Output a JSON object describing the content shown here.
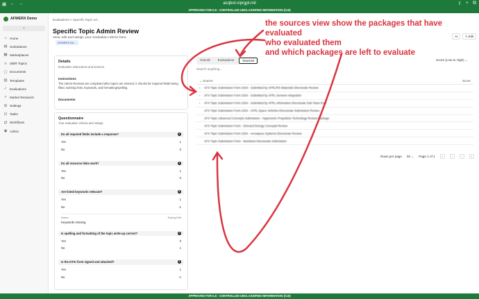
{
  "browser": {
    "url": "acqbot.niprgpt.mil"
  },
  "banner": {
    "text": "APPROVED FOR IL5 - CONTROLLED UNCLASSIFIED INFORMATION (CUI)"
  },
  "sidebar": {
    "org": "AFWERX Demo",
    "collapse_icon": "‹",
    "items": [
      {
        "label": "Home",
        "icon": "home-icon"
      },
      {
        "label": "Solicitations",
        "icon": "doc-icon"
      },
      {
        "label": "Marketplaces",
        "icon": "store-icon"
      },
      {
        "label": "SBIR Topics",
        "icon": "list-icon"
      },
      {
        "label": "Documents",
        "icon": "file-icon"
      },
      {
        "label": "Templates",
        "icon": "template-icon"
      },
      {
        "label": "Evaluations",
        "icon": "check-icon"
      },
      {
        "label": "Market Research",
        "icon": "search-icon"
      },
      {
        "label": "Settings",
        "icon": "gear-icon"
      },
      {
        "label": "Tasks",
        "icon": "task-icon"
      },
      {
        "label": "Workflows",
        "icon": "flow-icon"
      },
      {
        "label": "Admin",
        "icon": "admin-icon"
      }
    ]
  },
  "header": {
    "breadcrumb": "Evaluations >   Specific Topic Ad...",
    "title": "Specific Topic Admin Review",
    "subtitle": "View, edit and assign your evaluation rubrics here.",
    "tag": "AFWERX De...",
    "ai_label": "AI",
    "edit_label": "Edit"
  },
  "details": {
    "title": "Details",
    "subtitle": "Evaluation instructions and sources.",
    "instructions_label": "Instructions",
    "instructions_text": "The Admin Reviews are completed after topics are entered. It checks for required fields being filled, working links, keywords, and formatting/spelling.",
    "documents_label": "Documents"
  },
  "questionnaire": {
    "title": "Questionnaire",
    "subtitle": "Your evaluation criteria and ratings.",
    "questions": [
      {
        "q": "Do all required fields include a response?",
        "num": "1",
        "opts": [
          {
            "l": "Yes",
            "v": "1"
          },
          {
            "l": "No",
            "v": "0"
          }
        ]
      },
      {
        "q": "Do all resource links work?",
        "num": "1",
        "opts": [
          {
            "l": "Yes",
            "v": "1"
          },
          {
            "l": "No",
            "v": "0"
          }
        ]
      },
      {
        "q": "Are listed keywords relevant?",
        "num": "1",
        "opts": [
          {
            "l": "Yes",
            "v": "1"
          },
          {
            "l": "No",
            "v": "-1"
          }
        ],
        "notes_label": "Notes",
        "notes_meta": "Eating Edit",
        "notes_text": "Keywords missing"
      },
      {
        "q": "Is spelling and formatting of the topic write-up correct?",
        "num": "1",
        "opts": [
          {
            "l": "Yes",
            "v": "0"
          },
          {
            "l": "No",
            "v": "1"
          }
        ]
      },
      {
        "q": "Is the DTIC form signed and attached?",
        "num": "1",
        "opts": [
          {
            "l": "Yes",
            "v": "1"
          },
          {
            "l": "No",
            "v": "-1"
          }
        ]
      }
    ]
  },
  "sources_panel": {
    "tabs": [
      "Overall",
      "Evaluations",
      "Sources"
    ],
    "search_placeholder": "Search anything...",
    "sort_label": "Score (Low to High)",
    "col_source": "Source",
    "col_score": "Score",
    "rows": [
      "AFX Topic Submission Form 2024 - Submitted by AFRL/RX Materials Directorate Review",
      "AFX Topic Submission Form 2024 - Submitted by AFRL Sensors Integration",
      "AFX Topic Submission Form 2024 - Submitted by AFRL Information Directorate Sub-Team Eval",
      "AFX Topic Submission Form 2024 - AFRL Space Vehicles Directorate Submission Review",
      "AFX Topic Advanced Concepts Submission - Hypersonic Propulsion Technology Review Package",
      "AFX Topic Submission Form - Directed Energy Concepts Review",
      "AFX Topic Submission Form 2024 - Aerospace Systems Directorate Review",
      "AFX Topic Submission Form - Munitions Directorate Submission"
    ],
    "rows_per_page_label": "Rows per page",
    "rows_per_page": "30",
    "page_info": "Page 1 of 1"
  },
  "annotation": {
    "line1": "the sources view show the packages that have evaluated",
    "line2": "who evaluated them",
    "line3": "and which packages are left to evaluate",
    "color": "#d9333f"
  }
}
